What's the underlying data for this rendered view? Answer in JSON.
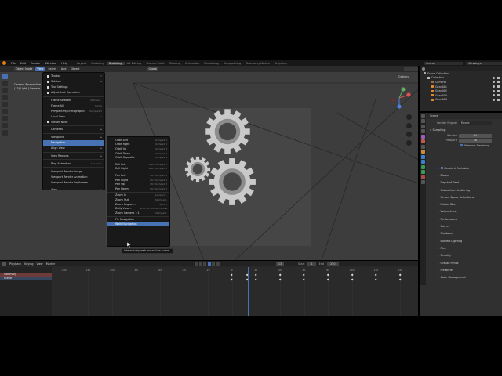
{
  "topbar": {
    "menus": [
      "File",
      "Edit",
      "Render",
      "Window",
      "Help"
    ],
    "workspaces": [
      {
        "label": "Layout",
        "active": false
      },
      {
        "label": "Modeling",
        "active": false
      },
      {
        "label": "Sculpting",
        "active": true
      },
      {
        "label": "UV Editing",
        "active": false
      },
      {
        "label": "Texture Paint",
        "active": false
      },
      {
        "label": "Shading",
        "active": false
      },
      {
        "label": "Animation",
        "active": false
      },
      {
        "label": "Rendering",
        "active": false
      },
      {
        "label": "Compositing",
        "active": false
      },
      {
        "label": "Geometry Nodes",
        "active": false
      },
      {
        "label": "Scripting",
        "active": false
      }
    ],
    "scene": "Scene",
    "view_layer": "ViewLayer"
  },
  "viewport": {
    "mode": "Object Mode",
    "header_menus": [
      "View",
      "Select",
      "Add",
      "Object"
    ],
    "transform_orientation": "Global",
    "options": "Options",
    "info_line1": "Camera Perspective",
    "info_line2": "(13) Light | Camera",
    "accent": "#4772b3"
  },
  "view_menu": {
    "items": [
      {
        "label": "Toolbar",
        "check": true,
        "shortcut": "T"
      },
      {
        "label": "Sidebar",
        "check": true,
        "shortcut": "N"
      },
      {
        "label": "Tool Settings",
        "check": true,
        "shortcut": ""
      },
      {
        "label": "Adjust Last Operation",
        "check": true,
        "shortcut": ""
      },
      {
        "sep": true
      },
      {
        "label": "Frame Selected",
        "shortcut": "Numpad ."
      },
      {
        "label": "Frame All",
        "shortcut": "Home"
      },
      {
        "label": "Perspective/Orthographic",
        "shortcut": "Numpad 5"
      },
      {
        "label": "Local View",
        "arrow": true
      },
      {
        "label": "Viewer Node",
        "check": true
      },
      {
        "sep": true
      },
      {
        "label": "Cameras",
        "arrow": true
      },
      {
        "sep": true
      },
      {
        "label": "Viewpoint",
        "arrow": true
      },
      {
        "label": "Navigation",
        "arrow": true,
        "highlight": true
      },
      {
        "label": "Align View",
        "arrow": true
      },
      {
        "sep": true
      },
      {
        "label": "View Regions",
        "arrow": true
      },
      {
        "sep": true
      },
      {
        "label": "Play Animation",
        "shortcut": "Spacebar"
      },
      {
        "sep": true
      },
      {
        "label": "Viewport Render Image"
      },
      {
        "label": "Viewport Render Animation"
      },
      {
        "label": "Viewport Render Keyframes"
      },
      {
        "sep": true
      },
      {
        "label": "Area",
        "arrow": true
      }
    ]
  },
  "nav_menu": {
    "items": [
      {
        "label": "Orbit Left",
        "shortcut": "Numpad 4"
      },
      {
        "label": "Orbit Right",
        "shortcut": "Numpad 6"
      },
      {
        "label": "Orbit Up",
        "shortcut": "Numpad 8"
      },
      {
        "label": "Orbit Down",
        "shortcut": "Numpad 2"
      },
      {
        "label": "Orbit Opposite",
        "shortcut": "Numpad 9"
      },
      {
        "sep": true
      },
      {
        "label": "Roll Left",
        "shortcut": "Shift Numpad 4"
      },
      {
        "label": "Roll Right",
        "shortcut": "Shift Numpad 6"
      },
      {
        "sep": true
      },
      {
        "label": "Pan Left",
        "shortcut": "Ctrl Numpad 4"
      },
      {
        "label": "Pan Right",
        "shortcut": "Ctrl Numpad 6"
      },
      {
        "label": "Pan Up",
        "shortcut": "Ctrl Numpad 8"
      },
      {
        "label": "Pan Down",
        "shortcut": "Ctrl Numpad 2"
      },
      {
        "sep": true
      },
      {
        "label": "Zoom In",
        "shortcut": "Numpad +"
      },
      {
        "label": "Zoom Out",
        "shortcut": "Numpad -"
      },
      {
        "label": "Zoom Region...",
        "shortcut": "Shift B"
      },
      {
        "label": "Dolly View...",
        "shortcut": "Shift Ctrl Middle Mouse"
      },
      {
        "label": "Zoom Camera 1:1",
        "shortcut": "Numpad ."
      },
      {
        "sep": true
      },
      {
        "label": "Fly Navigation",
        "shortcut": ""
      },
      {
        "label": "Walk Navigation",
        "shortcut": "",
        "highlight": true
      }
    ],
    "tooltip": "Interactively walk around the scene."
  },
  "outliner": {
    "title": "Scene Collection",
    "rows": [
      {
        "label": "Collection",
        "color": "#c0c0c0",
        "indent": 1
      },
      {
        "label": "Camera",
        "color": "#9c6f4a",
        "indent": 2
      },
      {
        "label": "Gear.001",
        "color": "#e08a2a",
        "indent": 2
      },
      {
        "label": "Gear.002",
        "color": "#e08a2a",
        "indent": 2
      },
      {
        "label": "Gear.003",
        "color": "#e08a2a",
        "indent": 2
      },
      {
        "label": "Gear.004",
        "color": "#e08a2a",
        "indent": 2
      }
    ]
  },
  "properties": {
    "title": "Scene",
    "render_engine_label": "Render Engine",
    "render_engine": "Eevee",
    "sampling": "Sampling",
    "render_label": "Render",
    "render_samples": "64",
    "viewport_label": "Viewport",
    "viewport_samples": "16",
    "viewport_denoising": "Viewport Denoising",
    "panels": [
      "Ambient Occlusion",
      "Bloom",
      "Depth of Field",
      "Subsurface Scattering",
      "Screen Space Reflections",
      "Motion Blur",
      "Volumetrics",
      "Performance",
      "Curves",
      "Shadows",
      "Indirect Lighting",
      "Film",
      "Simplify",
      "Grease Pencil",
      "Freestyle",
      "Color Management"
    ]
  },
  "timeline": {
    "menus": [
      "Playback",
      "Keying",
      "View",
      "Marker"
    ],
    "current_frame": "13",
    "start_label": "Start",
    "start": "1",
    "end_label": "End",
    "end": "250",
    "tracks": [
      "Summary",
      "Scene"
    ],
    "ruler": [
      "-140",
      "-120",
      "-100",
      "-80",
      "-60",
      "-40",
      "-20",
      "0",
      "20",
      "40",
      "60",
      "80",
      "100",
      "120",
      "140"
    ],
    "playhead_frame": 13
  }
}
